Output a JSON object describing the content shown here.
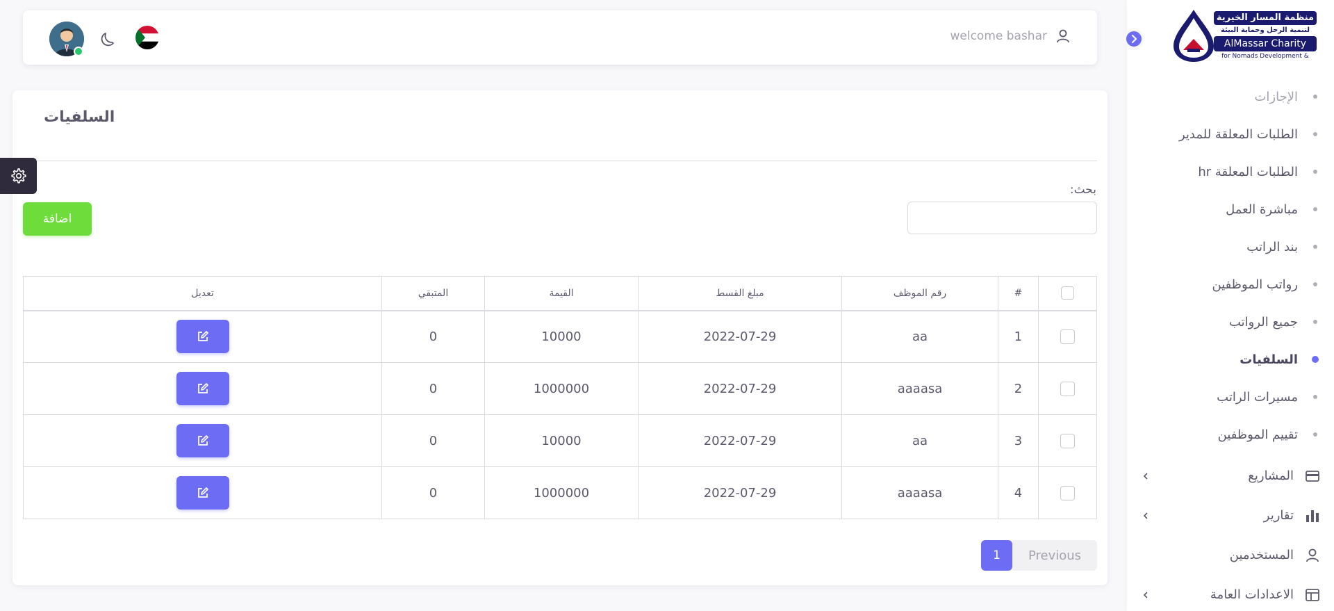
{
  "brand": {
    "name_ar": "منظمة المسار الخيرية",
    "subtitle_ar": "لتنمية الرحل وحماية البيئة",
    "name_en": "AlMassar Charity",
    "subtitle_en": "for Nomads Development &"
  },
  "topbar": {
    "welcome": "welcome bashar"
  },
  "sidebar": {
    "sub_items": [
      {
        "label": "الإجازات"
      },
      {
        "label": "الطلبات المعلقة للمدير"
      },
      {
        "label": "الطلبات المعلقة hr"
      },
      {
        "label": "مباشرة العمل"
      },
      {
        "label": "بند الراتب"
      },
      {
        "label": "رواتب الموظفين"
      },
      {
        "label": "جميع الرواتب"
      },
      {
        "label": "السلفيات"
      },
      {
        "label": "مسيرات الراتب"
      },
      {
        "label": "تقييم الموظفين"
      }
    ],
    "main_items": [
      {
        "label": "المشاريع"
      },
      {
        "label": "تقارير"
      },
      {
        "label": "المستخدمين"
      },
      {
        "label": "الاعدادات العامة"
      }
    ]
  },
  "page": {
    "title": "السلفيات",
    "search_label": "بحث:",
    "search_value": "",
    "add_label": "اضافة"
  },
  "table": {
    "headers": {
      "index": "#",
      "employee_no": "رقم الموظف",
      "installment": "مبلغ القسط",
      "value": "القيمة",
      "remaining": "المتبقي",
      "edit": "تعديل"
    },
    "rows": [
      {
        "index": "1",
        "employee_no": "aa",
        "installment": "2022-07-29",
        "value": "10000",
        "remaining": "0"
      },
      {
        "index": "2",
        "employee_no": "aaaasa",
        "installment": "2022-07-29",
        "value": "1000000",
        "remaining": "0"
      },
      {
        "index": "3",
        "employee_no": "aa",
        "installment": "2022-07-29",
        "value": "10000",
        "remaining": "0"
      },
      {
        "index": "4",
        "employee_no": "aaaasa",
        "installment": "2022-07-29",
        "value": "1000000",
        "remaining": "0"
      }
    ]
  },
  "pagination": {
    "current": "1",
    "previous": "Previous"
  },
  "colors": {
    "primary": "#6d6cf5",
    "add": "#6edd3c",
    "online": "#28c76f",
    "brand": "#1a1a6e"
  }
}
